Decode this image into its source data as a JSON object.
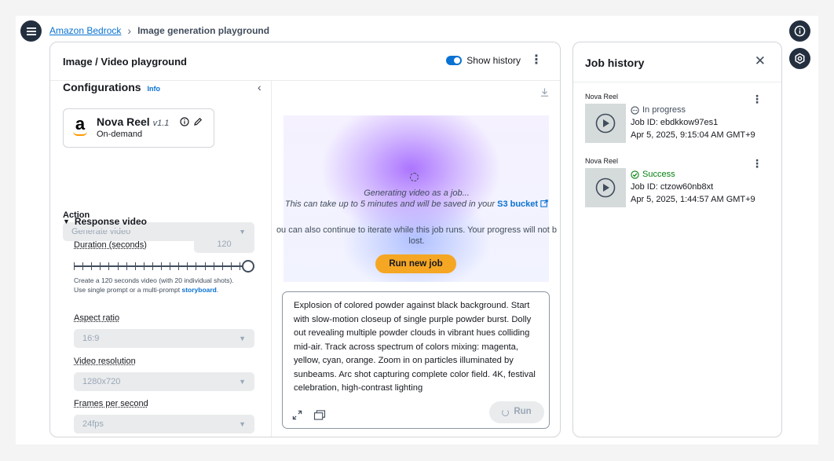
{
  "breadcrumb": {
    "root": "Amazon Bedrock",
    "current": "Image generation playground"
  },
  "main": {
    "title": "Image / Video playground",
    "show_history_label": "Show history",
    "show_history_on": true
  },
  "config": {
    "title": "Configurations",
    "info": "Info",
    "model": {
      "name": "Nova Reel",
      "version": "v1.1",
      "throughput": "On-demand"
    },
    "action_label": "Action",
    "action_value": "Generate video",
    "response_section": "Response video",
    "duration_label": "Duration (seconds)",
    "duration_value": "120",
    "duration_fraction": 1.0,
    "helper_prefix": "Create a 120 seconds video (with 20 individual shots). Use single prompt or a multi-prompt ",
    "helper_link": "storyboard",
    "helper_suffix": ".",
    "aspect_label": "Aspect ratio",
    "aspect_value": "16:9",
    "resolution_label": "Video resolution",
    "resolution_value": "1280x720",
    "fps_label": "Frames per second",
    "fps_value": "24fps"
  },
  "preview": {
    "generating": "Generating video as a job...",
    "wait_prefix": "This can take up to 5 minutes and will be saved in your ",
    "s3_link": "S3 bucket",
    "iterate_line1": "ou can also continue to iterate while this job runs. Your progress will not b",
    "iterate_line2": "lost.",
    "run_new_job": "Run new job",
    "prompt": "Explosion of colored powder against black background. Start with slow-motion closeup of single purple powder burst. Dolly out revealing multiple powder clouds in vibrant hues colliding mid-air. Track across spectrum of colors mixing: magenta, yellow, cyan, orange. Zoom in on particles illuminated by sunbeams. Arc shot capturing complete color field. 4K, festival celebration, high-contrast lighting",
    "run_label": "Run"
  },
  "history": {
    "title": "Job history",
    "jobs": [
      {
        "model": "Nova Reel",
        "status": "In progress",
        "job_id": "Job ID: ebdkkow97es1",
        "date": "Apr 5, 2025, 9:15:04 AM GMT+9"
      },
      {
        "model": "Nova Reel",
        "status": "Success",
        "job_id": "Job ID: ctzow60nb8xt",
        "date": "Apr 5, 2025, 1:44:57 AM GMT+9"
      }
    ]
  },
  "colors": {
    "accent": "#0972d3",
    "primary_button": "#f5a623",
    "success": "#037f0c",
    "nav_dark": "#232f3e"
  }
}
